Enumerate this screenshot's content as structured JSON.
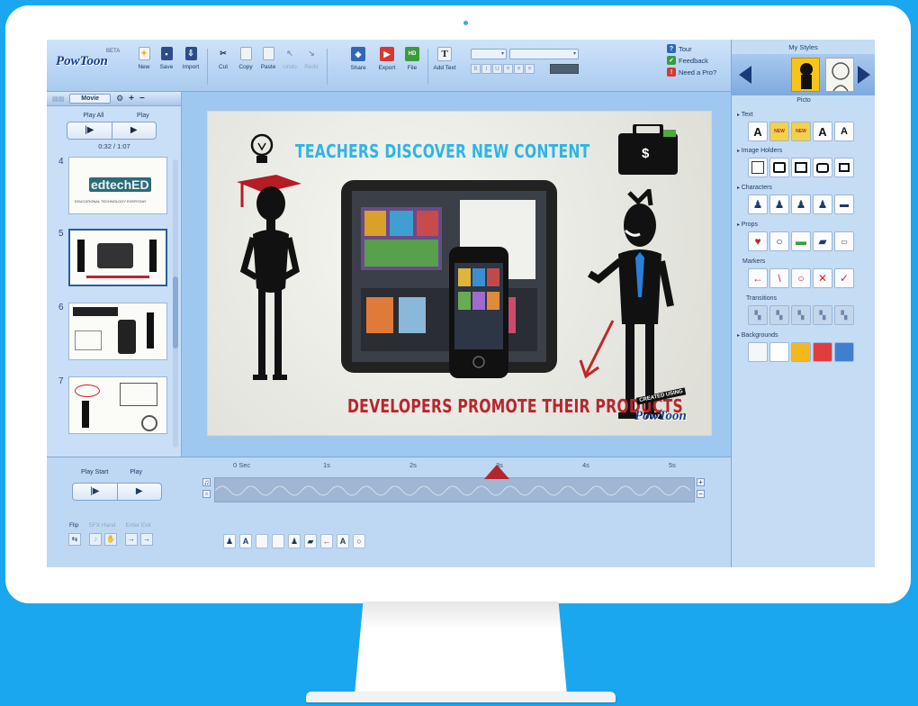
{
  "toolbar": {
    "logo_text": "PowToon",
    "beta": "BETA",
    "buttons": {
      "new": "New",
      "save": "Save",
      "import": "Import",
      "cut": "Cut",
      "copy": "Copy",
      "paste": "Paste",
      "undo": "Undo",
      "redo": "Redo",
      "share": "Share",
      "export": "Export",
      "file": "File",
      "add_text": "Add Text"
    },
    "format_buttons": [
      "B",
      "I",
      "U"
    ],
    "links": {
      "tour": "Tour",
      "feedback": "Feedback",
      "need_pro": "Need a Pro?"
    }
  },
  "slides_panel": {
    "tab": "Movie",
    "play_all": "Play All",
    "play": "Play",
    "time": "0:32 / 1:07",
    "slides": [
      {
        "number": "4",
        "title": "edtechED",
        "subtitle": "EDUCATIONAL TECHNOLOGY EVERYDAY"
      },
      {
        "number": "5",
        "title": "",
        "subtitle": ""
      },
      {
        "number": "6",
        "title": "",
        "subtitle": ""
      },
      {
        "number": "7",
        "title": "",
        "subtitle": ""
      }
    ]
  },
  "stage": {
    "heading_top": "TEACHERS DISCOVER NEW CONTENT",
    "heading_bottom": "DEVELOPERS PROMOTE THEIR PRODUCTS",
    "badge_top": "CREATED USING",
    "badge_logo": "PowToon",
    "money_symbol": "$"
  },
  "timeline": {
    "play_start": "Play Start",
    "play": "Play",
    "ticks": [
      "0 Sec",
      "1s",
      "2s",
      "3s",
      "4s",
      "5s"
    ],
    "fx_labels": [
      "Flip",
      "SFX Hand",
      "Enter Exit"
    ]
  },
  "styles_panel": {
    "title": "My Styles",
    "selected_style": "Picto",
    "categories": [
      "Text",
      "Image Holders",
      "Characters",
      "Props",
      "Markers",
      "Transitions",
      "Backgrounds"
    ],
    "text_tiles": [
      "A",
      "NEW",
      "NEW",
      "A",
      "A"
    ],
    "marker_tiles": [
      "←",
      "\\",
      "○",
      "✕",
      "✓"
    ],
    "background_colors": [
      "#f4f6f8",
      "#ffffff",
      "#f4b81c",
      "#e23c3c",
      "#3f7fd0"
    ]
  }
}
